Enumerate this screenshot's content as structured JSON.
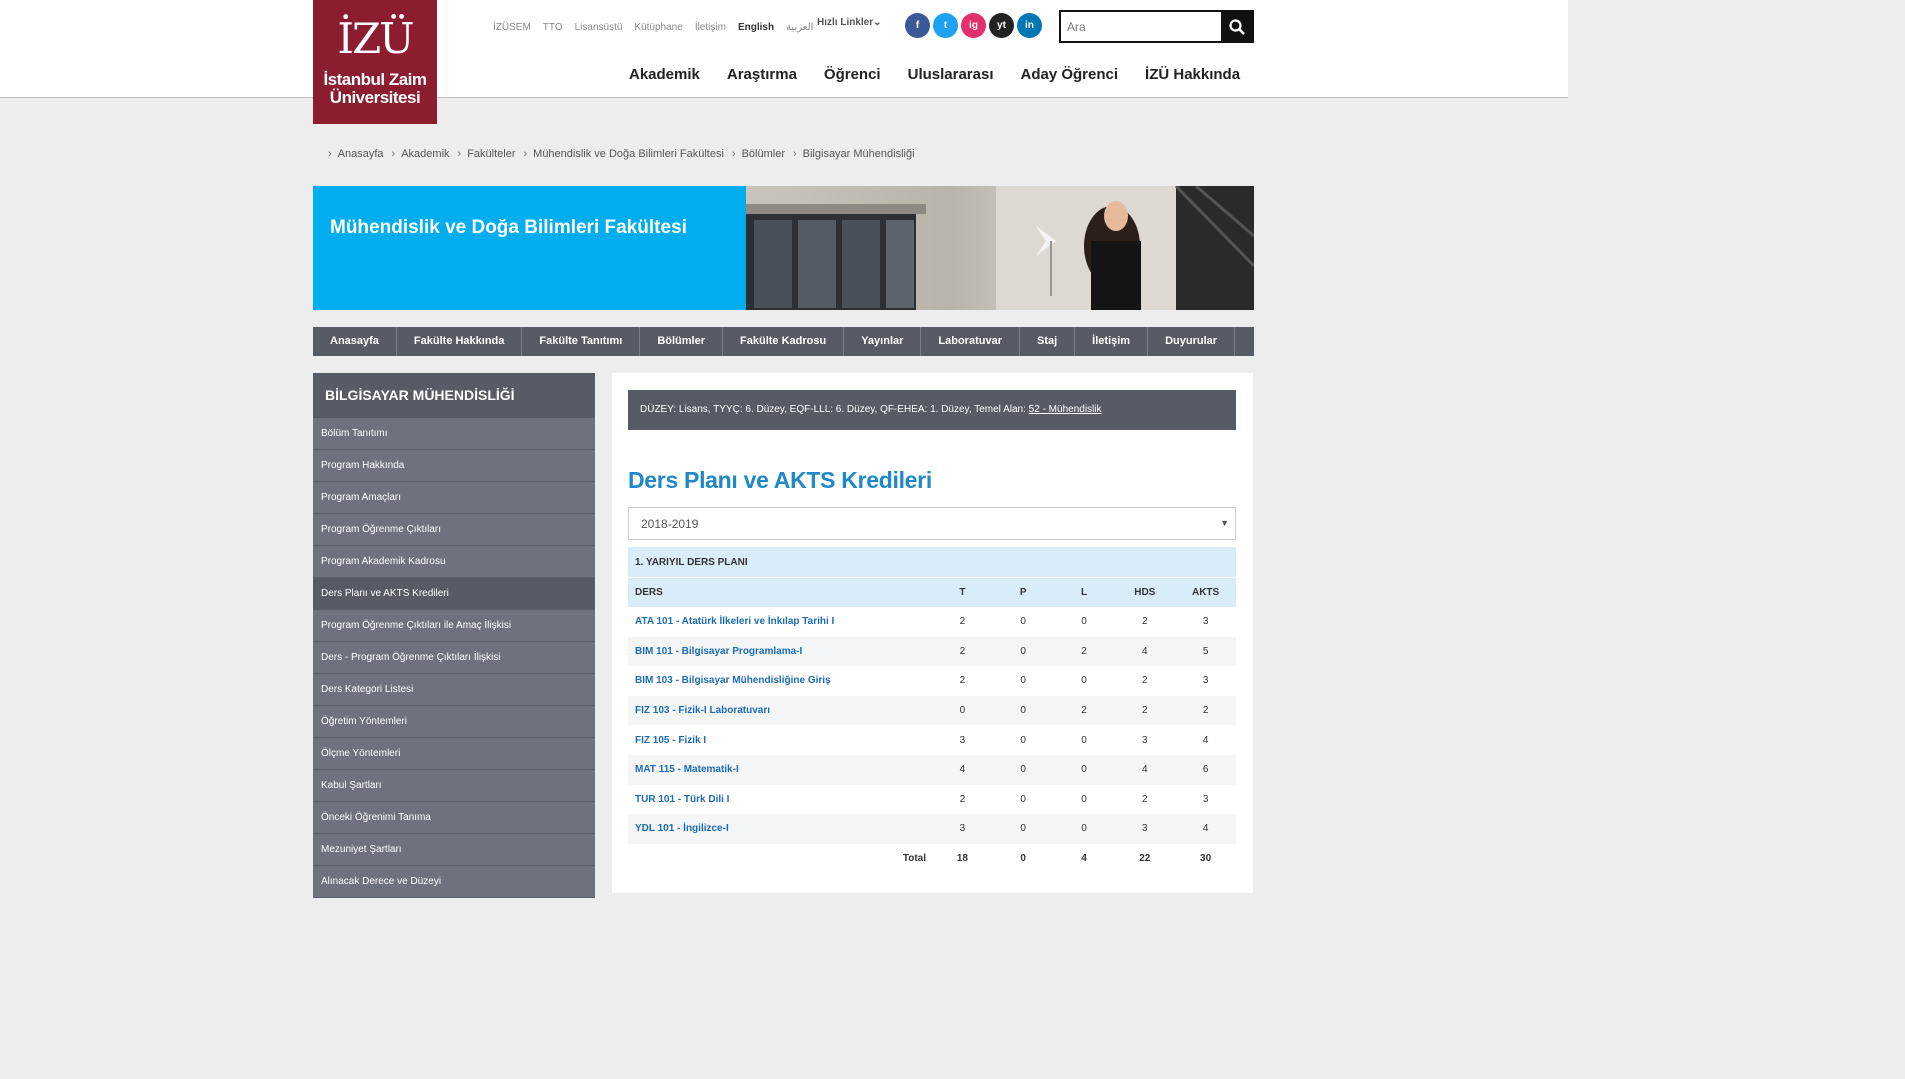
{
  "logo": {
    "mark": "İZÜ",
    "line1": "İstanbul Zaim",
    "line2": "Üniversitesi"
  },
  "toplinks": [
    "İZÜSEM",
    "TTO",
    "Lisansüstü",
    "Kütüphane",
    "İletişim",
    "English",
    "العربية"
  ],
  "quicklinks": "Hızlı Linkler",
  "social": [
    {
      "label": "f",
      "color": "#3b5998",
      "icon": "facebook-icon"
    },
    {
      "label": "t",
      "color": "#1da1f2",
      "icon": "twitter-icon"
    },
    {
      "label": "ig",
      "color": "#e1306c",
      "icon": "instagram-icon"
    },
    {
      "label": "yt",
      "color": "#222222",
      "icon": "youtube-icon"
    },
    {
      "label": "in",
      "color": "#0077b5",
      "icon": "linkedin-icon"
    }
  ],
  "search": {
    "placeholder": "Ara"
  },
  "mainnav": [
    "Akademik",
    "Araştırma",
    "Öğrenci",
    "Uluslararası",
    "Aday Öğrenci",
    "İZÜ Hakkında"
  ],
  "breadcrumb": [
    "Anasayfa",
    "Akademik",
    "Fakülteler",
    "Mühendislik ve Doğa Bilimleri Fakültesi",
    "Bölümler",
    "Bilgisayar Mühendisliği"
  ],
  "banner": {
    "title": "Mühendislik ve Doğa Bilimleri Fakültesi"
  },
  "facnav": [
    "Anasayfa",
    "Fakülte Hakkında",
    "Fakülte Tanıtımı",
    "Bölümler",
    "Fakülte Kadrosu",
    "Yayınlar",
    "Laboratuvar",
    "Staj",
    "İletişim",
    "Duyurular"
  ],
  "sidebar": {
    "title": "BİLGİSAYAR MÜHENDİSLİĞİ",
    "items": [
      "Bölüm Tanıtımı",
      "Program Hakkında",
      "Program Amaçları",
      "Program Öğrenme Çıktıları",
      "Program Akademik Kadrosu",
      "Ders Planı ve AKTS Kredileri",
      "Program Öğrenme Çıktıları ile Amaç İlişkisi",
      "Ders - Program Öğrenme Çıktıları İlişkisi",
      "Ders Kategori Listesi",
      "Öğretim Yöntemleri",
      "Ölçme Yöntemleri",
      "Kabul Şartları",
      "Önceki Öğrenimi Tanıma",
      "Mezuniyet Şartları",
      "Alınacak Derece ve Düzeyi"
    ],
    "active": "Ders Planı ve AKTS Kredileri"
  },
  "content": {
    "level_text": "DÜZEY: Lisans, TYYÇ: 6. Düzey, EQF-LLL: 6. Düzey, QF-EHEA: 1. Düzey, Temel Alan: ",
    "level_link": "52 - Mühendislik",
    "title": "Ders Planı ve AKTS Kredileri",
    "year": "2018-2019",
    "semester": "1. YARIYIL DERS PLANI",
    "headers": [
      "DERS",
      "T",
      "P",
      "L",
      "HDS",
      "AKTS"
    ],
    "rows": [
      [
        "ATA 101 - Atatürk İlkeleri ve İnkılap Tarihi I",
        "2",
        "0",
        "0",
        "2",
        "3"
      ],
      [
        "BIM 101 - Bilgisayar Programlama-I",
        "2",
        "0",
        "2",
        "4",
        "5"
      ],
      [
        "BIM 103 - Bilgisayar Mühendisliğine Giriş",
        "2",
        "0",
        "0",
        "2",
        "3"
      ],
      [
        "FIZ 103 - Fizik-I Laboratuvarı",
        "0",
        "0",
        "2",
        "2",
        "2"
      ],
      [
        "FIZ 105 - Fizik I",
        "3",
        "0",
        "0",
        "3",
        "4"
      ],
      [
        "MAT 115 - Matematik-I",
        "4",
        "0",
        "0",
        "4",
        "6"
      ],
      [
        "TUR 101 - Türk Dili I",
        "2",
        "0",
        "0",
        "2",
        "3"
      ],
      [
        "YDL 101 - İngilizce-I",
        "3",
        "0",
        "0",
        "3",
        "4"
      ]
    ],
    "total": [
      "Total",
      "18",
      "0",
      "4",
      "22",
      "30"
    ]
  }
}
